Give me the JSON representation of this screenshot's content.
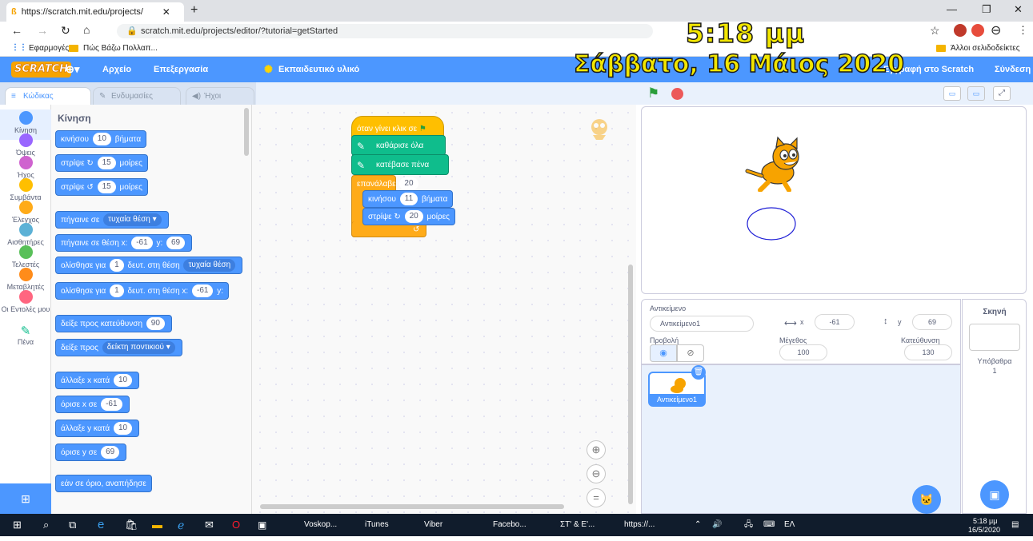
{
  "browser": {
    "tab_title": "https://scratch.mit.edu/projects/",
    "url": "scratch.mit.edu/projects/editor/?tutorial=getStarted",
    "bookmarks": [
      "Εφαρμογές",
      "Πώς Βάζω Πολλαπ..."
    ],
    "other_bookmarks": "Άλλοι σελιδοδείκτες"
  },
  "overlay": {
    "time": "5:18 μμ",
    "date": "Σάββατο, 16 Μάιος 2020"
  },
  "menubar": {
    "logo": "SCRATCH",
    "file": "Αρχείο",
    "edit": "Επεξεργασία",
    "tutorials": "Εκπαιδευτικό υλικό",
    "signin": "Σύνδεση",
    "join": "Εγγραφή στο Scratch"
  },
  "editor_tabs": {
    "code": "Κώδικας",
    "costumes": "Ενδυμασίες",
    "sounds": "Ήχοι"
  },
  "categories": [
    {
      "label": "Κίνηση",
      "color": "#4c97ff"
    },
    {
      "label": "Όψεις",
      "color": "#9966ff"
    },
    {
      "label": "Ήχος",
      "color": "#cf63cf"
    },
    {
      "label": "Συμβάντα",
      "color": "#ffbf00"
    },
    {
      "label": "Έλεγχος",
      "color": "#ffab19"
    },
    {
      "label": "Αισθητήρες",
      "color": "#5cb1d6"
    },
    {
      "label": "Τελεστές",
      "color": "#59c059"
    },
    {
      "label": "Μεταβλητές",
      "color": "#ff8c1a"
    },
    {
      "label": "Οι Εντολές μου",
      "color": "#ff6680"
    },
    {
      "label": "Πένα",
      "color": "#0fbd8c"
    }
  ],
  "palette": {
    "heading": "Κίνηση",
    "blocks": {
      "move": {
        "text": "κινήσου",
        "value": "10",
        "tail": "βήματα"
      },
      "turn_right": {
        "text": "στρίψε ↻",
        "value": "15",
        "tail": "μοίρες"
      },
      "turn_left": {
        "text": "στρίψε ↺",
        "value": "15",
        "tail": "μοίρες"
      },
      "goto": {
        "text": "πήγαινε σε",
        "dropdown": "τυχαία θέση ▾"
      },
      "goto_xy": {
        "text": "πήγαινε σε θέση x:",
        "x": "-61",
        "ylabel": "y:",
        "y": "69"
      },
      "glide": {
        "text": "ολίσθησε για",
        "value": "1",
        "mid": "δευτ. στη θέση",
        "dropdown": "τυχαία θέση"
      },
      "glide_xy": {
        "text": "ολίσθησε για",
        "value": "1",
        "mid": "δευτ. στη θέση x:",
        "x": "-61",
        "ylabel": "y:"
      },
      "point_dir": {
        "text": "δείξε προς κατεύθυνση",
        "value": "90"
      },
      "point_towards": {
        "text": "δείξε προς",
        "dropdown": "δείκτη ποντικιού ▾"
      },
      "change_x": {
        "text": "άλλαξε x κατά",
        "value": "10"
      },
      "set_x": {
        "text": "όρισε x σε",
        "value": "-61"
      },
      "change_y": {
        "text": "άλλαξε y κατά",
        "value": "10"
      },
      "set_y": {
        "text": "όρισε y σε",
        "value": "69"
      },
      "bounce": {
        "text": "εάν σε όριο, αναπήδησε"
      }
    }
  },
  "script": {
    "hat": "όταν γίνει κλικ σε",
    "clear": "καθάρισε όλα",
    "pen_down": "κατέβασε πένα",
    "repeat": {
      "text": "επανάλαβε",
      "value": "20"
    },
    "move": {
      "text": "κινήσου",
      "value": "11",
      "tail": "βήματα"
    },
    "turn": {
      "text": "στρίψε ↻",
      "value": "20",
      "tail": "μοίρες"
    }
  },
  "sprite_info": {
    "sprite_label": "Αντικείμενο",
    "sprite_name": "Αντικείμενο1",
    "x_label": "x",
    "x": "-61",
    "y_label": "y",
    "y": "69",
    "show_label": "Προβολή",
    "size_label": "Μέγεθος",
    "size": "100",
    "direction_label": "Κατεύθυνση",
    "direction": "130"
  },
  "sprites": [
    {
      "name": "Αντικείμενο1"
    }
  ],
  "stage_panel": {
    "title": "Σκηνή",
    "backdrops_label": "Υπόβαθρα",
    "backdrops_count": "1"
  },
  "taskbar": {
    "apps": [
      "Voskop...",
      "iTunes",
      "Viber",
      "Facebo...",
      "ΣΤ' & Ε'...",
      "https://..."
    ],
    "lang": "ΕΛ",
    "time": "5:18 μμ",
    "date": "16/5/2020"
  },
  "colors": {
    "accent": "#4c97ff",
    "overlay_text": "#f2e600"
  }
}
